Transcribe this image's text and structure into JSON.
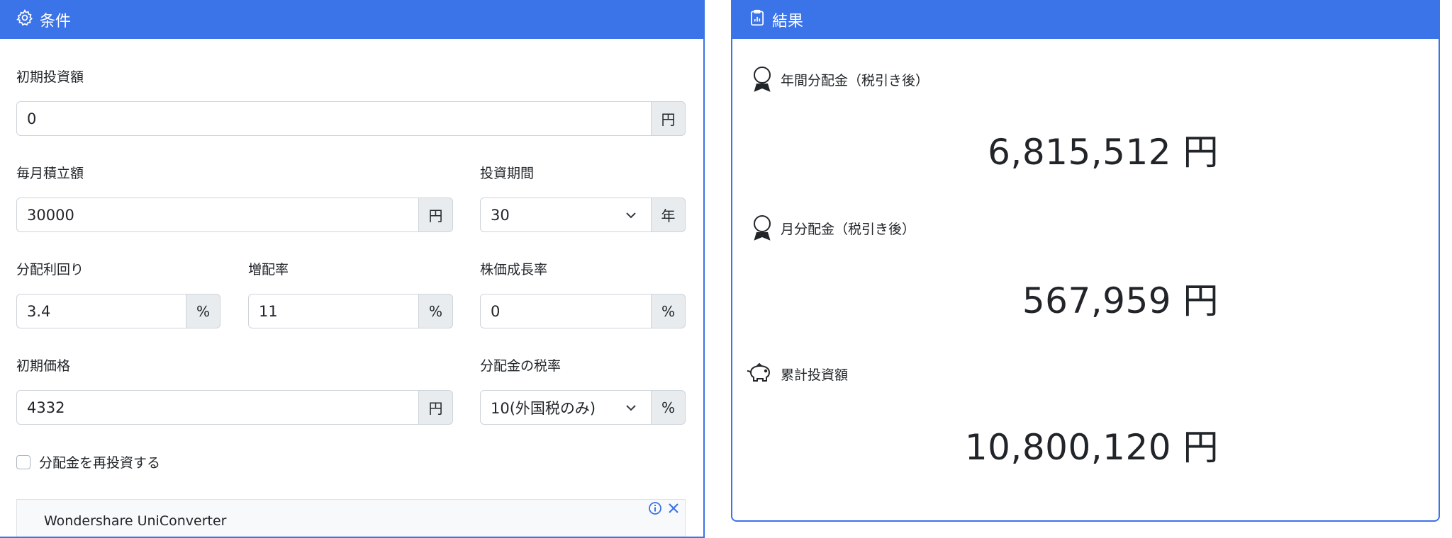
{
  "conditions": {
    "title": "条件",
    "initial_investment": {
      "label": "初期投資額",
      "value": "0",
      "unit": "円"
    },
    "monthly_contribution": {
      "label": "毎月積立額",
      "value": "30000",
      "unit": "円"
    },
    "investment_period": {
      "label": "投資期間",
      "value": "30",
      "unit": "年"
    },
    "dividend_yield": {
      "label": "分配利回り",
      "value": "3.4",
      "unit": "%"
    },
    "dividend_growth": {
      "label": "増配率",
      "value": "11",
      "unit": "%"
    },
    "price_growth": {
      "label": "株価成長率",
      "value": "0",
      "unit": "%"
    },
    "initial_price": {
      "label": "初期価格",
      "value": "4332",
      "unit": "円"
    },
    "tax_rate": {
      "label": "分配金の税率",
      "value": "10(外国税のみ)",
      "unit": "%"
    },
    "reinvest": {
      "label": "分配金を再投資する",
      "checked": false
    },
    "ad": {
      "title": "Wondershare UniConverter"
    }
  },
  "results": {
    "title": "結果",
    "annual_dividend": {
      "label": "年間分配金（税引き後）",
      "value": "6,815,512 円"
    },
    "monthly_dividend": {
      "label": "月分配金（税引き後）",
      "value": "567,959 円"
    },
    "total_investment": {
      "label": "累計投資額",
      "value": "10,800,120 円"
    }
  },
  "colors": {
    "accent": "#3b73e8",
    "addon_bg": "#e9ecef",
    "border": "#ced4da"
  }
}
